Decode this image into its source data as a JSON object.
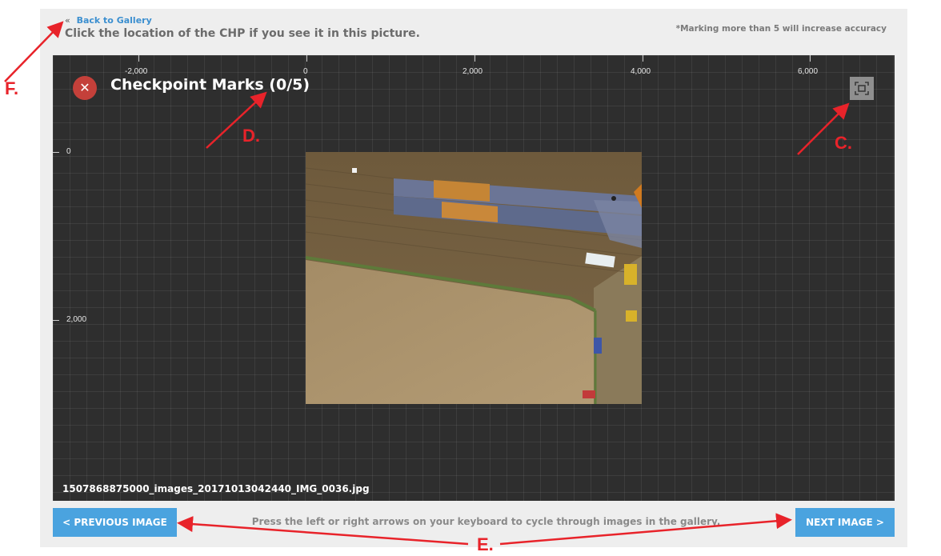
{
  "header": {
    "back_label": "Back to Gallery",
    "back_chevron": "«",
    "instruction": "Click the location of the CHP if you see it in this picture.",
    "accuracy_note": "*Marking more than 5 will increase accuracy"
  },
  "canvas": {
    "title": "Checkpoint Marks (0/5)",
    "close_symbol": "✕",
    "filename": "1507868875000_images_20171013042440_IMG_0036.jpg",
    "filename_overlap": "160",
    "x_ticks": [
      "-2,000",
      "0",
      "2,000",
      "4,000",
      "6,000"
    ],
    "y_ticks": [
      "0",
      "2,000"
    ]
  },
  "footer": {
    "prev_label": "< PREVIOUS IMAGE",
    "next_label": "NEXT IMAGE >",
    "hint": "Press the left or right arrows on your keyboard to cycle through images in the gallery."
  },
  "annotations": {
    "c": "C.",
    "d": "D.",
    "e": "E.",
    "f": "F."
  },
  "colors": {
    "accent_blue": "#4aa3df",
    "close_red": "#c4403a",
    "annotation_red": "#e8232a",
    "canvas_bg": "#2e2e2e"
  },
  "icons": {
    "close": "close-icon",
    "fit": "fit-to-screen-icon",
    "back": "double-chevron-left-icon"
  }
}
